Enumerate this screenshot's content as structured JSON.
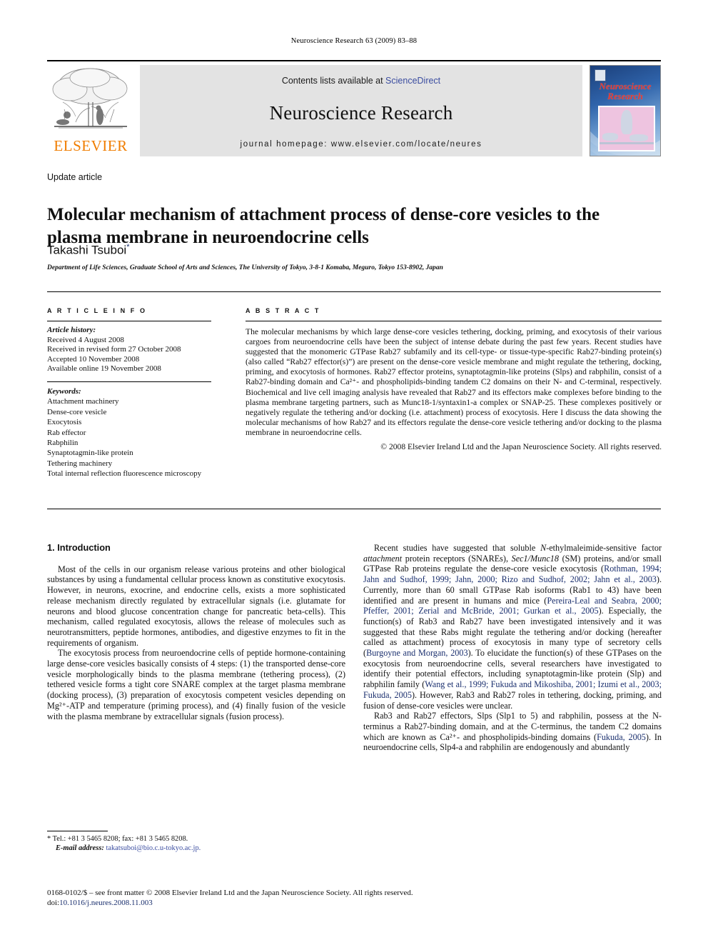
{
  "running_head": "Neuroscience Research 63 (2009) 83–88",
  "masthead": {
    "publisher_name": "ELSEVIER",
    "contents_prefix": "Contents lists available at ",
    "sciencedirect": "ScienceDirect",
    "journal_title": "Neuroscience Research",
    "homepage": "journal homepage: www.elsevier.com/locate/neures",
    "cover_title_line1": "Neuroscience",
    "cover_title_line2": "Research",
    "accent_orange": "#f07d00",
    "link_blue": "#3b4da0",
    "citation_navy": "#1a2f6e",
    "cover_red": "#e8382e"
  },
  "article": {
    "type_label": "Update article",
    "title": "Molecular mechanism of attachment process of dense-core vesicles to the plasma membrane in neuroendocrine cells",
    "author": "Takashi Tsuboi",
    "author_marker": "*",
    "affiliation": "Department of Life Sciences, Graduate School of Arts and Sciences, The University of Tokyo, 3-8-1 Komaba, Meguro, Tokyo 153-8902, Japan"
  },
  "info": {
    "heading": "A R T I C L E   I N F O",
    "history_label": "Article history:",
    "history": [
      "Received 4 August 2008",
      "Received in revised form 27 October 2008",
      "Accepted 10 November 2008",
      "Available online 19 November 2008"
    ],
    "keywords_label": "Keywords:",
    "keywords": [
      "Attachment machinery",
      "Dense-core vesicle",
      "Exocytosis",
      "Rab effector",
      "Rabphilin",
      "Synaptotagmin-like protein",
      "Tethering machinery",
      "Total internal reflection fluorescence microscopy"
    ]
  },
  "abstract": {
    "heading": "A B S T R A C T",
    "text": "The molecular mechanisms by which large dense-core vesicles tethering, docking, priming, and exocytosis of their various cargoes from neuroendocrine cells have been the subject of intense debate during the past few years. Recent studies have suggested that the monomeric GTPase Rab27 subfamily and its cell-type- or tissue-type-specific Rab27-binding protein(s) (also called “Rab27 effector(s)”) are present on the dense-core vesicle membrane and might regulate the tethering, docking, priming, and exocytosis of hormones. Rab27 effector proteins, synaptotagmin-like proteins (Slps) and rabphilin, consist of a Rab27-binding domain and Ca²⁺- and phospholipids-binding tandem C2 domains on their N- and C-terminal, respectively. Biochemical and live cell imaging analysis have revealed that Rab27 and its effectors make complexes before binding to the plasma membrane targeting partners, such as Munc18-1/syntaxin1-a complex or SNAP-25. These complexes positively or negatively regulate the tethering and/or docking (i.e. attachment) process of exocytosis. Here I discuss the data showing the molecular mechanisms of how Rab27 and its effectors regulate the dense-core vesicle tethering and/or docking to the plasma membrane in neuroendocrine cells.",
    "copyright": "© 2008 Elsevier Ireland Ltd and the Japan Neuroscience Society. All rights reserved."
  },
  "body": {
    "section_heading": "1. Introduction",
    "left_paragraphs": [
      "Most of the cells in our organism release various proteins and other biological substances by using a fundamental cellular process known as constitutive exocytosis. However, in neurons, exocrine, and endocrine cells, exists a more sophisticated release mechanism directly regulated by extracellular signals (i.e. glutamate for neurons and blood glucose concentration change for pancreatic beta-cells). This mechanism, called regulated exocytosis, allows the release of molecules such as neurotransmitters, peptide hormones, antibodies, and digestive enzymes to fit in the requirements of organism.",
      "The exocytosis process from neuroendocrine cells of peptide hormone-containing large dense-core vesicles basically consists of 4 steps: (1) the transported dense-core vesicle morphologically binds to the plasma membrane (tethering process), (2) tethered vesicle forms a tight core SNARE complex at the target plasma membrane (docking process), (3) preparation of exocytosis competent vesicles depending on Mg²⁺-ATP and temperature (priming process), and (4) finally fusion of the vesicle with the plasma membrane by extracellular signals (fusion process)."
    ],
    "right_paragraph_1": {
      "part1": "Recent studies have suggested that soluble ",
      "em1": "N",
      "part2": "-ethylmaleimide-sensitive factor ",
      "em2": "attachment",
      "part3": " protein receptors (SNAREs), ",
      "em3": "Sec1/Munc18",
      "part4": " (SM) proteins, and/or small GTPase Rab proteins regulate the dense-core vesicle exocytosis (",
      "cit1": "Rothman, 1994; Jahn and Sudhof, 1999; Jahn, 2000; Rizo and Sudhof, 2002; Jahn et al., 2003",
      "part5": "). Currently, more than 60 small GTPase Rab isoforms (Rab1 to 43) have been identified and are present in humans and mice (",
      "cit2": "Pereira-Leal and Seabra, 2000; Pfeffer, 2001; Zerial and McBride, 2001; Gurkan et al., 2005",
      "part6": "). Especially, the function(s) of Rab3 and Rab27 have been investigated intensively and it was suggested that these Rabs might regulate the tethering and/or docking (hereafter called as attachment) process of exocytosis in many type of secretory cells (",
      "cit3": "Burgoyne and Morgan, 2003",
      "part7": "). To elucidate the function(s) of these GTPases on the exocytosis from neuroendocrine cells, several researchers have investigated to identify their potential effectors, including synaptotagmin-like protein (Slp) and rabphilin family (",
      "cit4": "Wang et al., 1999; Fukuda and Mikoshiba, 2001; Izumi et al., 2003; Fukuda, 2005",
      "part8": "). However, Rab3 and Rab27 roles in tethering, docking, priming, and fusion of dense-core vesicles were unclear."
    },
    "right_paragraph_2": {
      "part1": "Rab3 and Rab27 effectors, Slps (Slp1 to 5) and rabphilin, possess at the N-terminus a Rab27-binding domain, and at the C-terminus, the tandem C2 domains which are known as Ca²⁺- and phospholipids-binding domains (",
      "cit1": "Fukuda, 2005",
      "part2": "). In neuroendocrine cells, Slp4-a and rabphilin are endogenously and abundantly"
    }
  },
  "footnotes": {
    "tel": "* Tel.: +81 3 5465 8208; fax: +81 3 5465 8208.",
    "email_label": "E-mail address:",
    "email": "takatsuboi@bio.c.u-tokyo.ac.jp."
  },
  "imprint": {
    "line1": "0168-0102/$ – see front matter © 2008 Elsevier Ireland Ltd and the Japan Neuroscience Society. All rights reserved.",
    "doi_label": "doi:",
    "doi": "10.1016/j.neures.2008.11.003"
  }
}
